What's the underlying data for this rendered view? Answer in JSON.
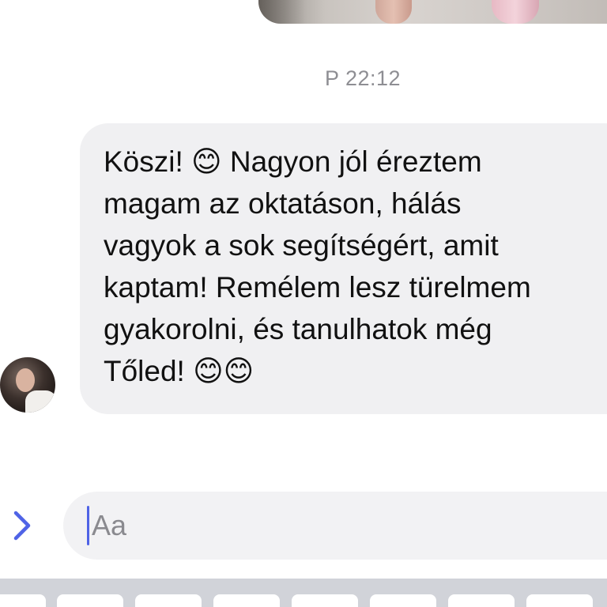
{
  "chat": {
    "timestamp": "P 22:12",
    "message": "Köszi! 😊 Nagyon jól éreztem\nmagam az oktatáson, hálás\nvagyok a sok segítségért, amit\nkaptam! Remélem lesz türelmem\ngyakorolni, és tanulhatok még\nTőled! 😊😊"
  },
  "composer": {
    "placeholder": "Aa",
    "value": ""
  },
  "icons": {
    "expand": "chevron-right-icon",
    "emoji": "emoji-icon"
  },
  "colors": {
    "accent": "#4f63e6",
    "bubble": "#f0f0f2",
    "timestamp": "#8e8e93"
  }
}
